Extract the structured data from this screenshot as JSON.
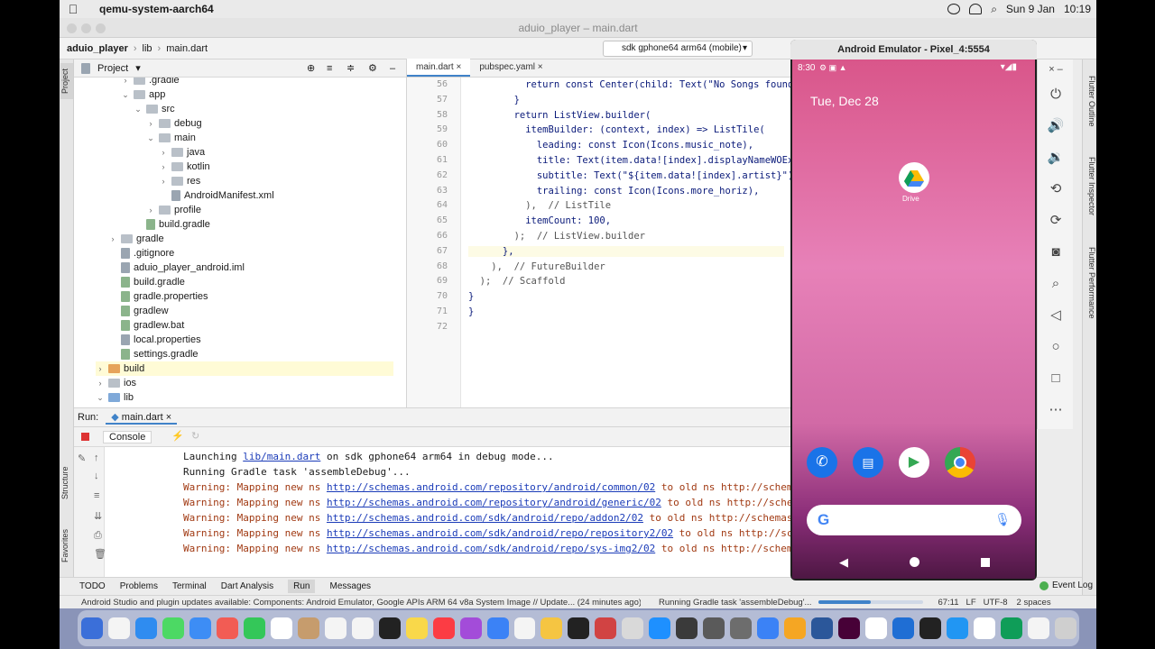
{
  "mac_menubar": {
    "apple": "",
    "app_name": "qemu-system-aarch64",
    "date": "Sun 9 Jan",
    "time": "10:19"
  },
  "window": {
    "title": "aduio_player – main.dart"
  },
  "nav": {
    "project": "aduio_player",
    "dir": "lib",
    "file": "main.dart",
    "device": "sdk gphone64 arm64 (mobile)"
  },
  "left_tool_tabs": [
    "Project",
    "Structure",
    "Favorites"
  ],
  "project_panel": {
    "title": "Project",
    "items": [
      {
        "label": ".gradle",
        "depth": 2,
        "arrow": "›",
        "kind": "folder"
      },
      {
        "label": "app",
        "depth": 2,
        "arrow": "⌄",
        "kind": "folder"
      },
      {
        "label": "src",
        "depth": 3,
        "arrow": "⌄",
        "kind": "folder"
      },
      {
        "label": "debug",
        "depth": 4,
        "arrow": "›",
        "kind": "folder"
      },
      {
        "label": "main",
        "depth": 4,
        "arrow": "⌄",
        "kind": "folder"
      },
      {
        "label": "java",
        "depth": 5,
        "arrow": "›",
        "kind": "folder"
      },
      {
        "label": "kotlin",
        "depth": 5,
        "arrow": "›",
        "kind": "folder"
      },
      {
        "label": "res",
        "depth": 5,
        "arrow": "›",
        "kind": "folder"
      },
      {
        "label": "AndroidManifest.xml",
        "depth": 5,
        "arrow": "",
        "kind": "file"
      },
      {
        "label": "profile",
        "depth": 4,
        "arrow": "›",
        "kind": "folder"
      },
      {
        "label": "build.gradle",
        "depth": 3,
        "arrow": "",
        "kind": "file"
      },
      {
        "label": "gradle",
        "depth": 1,
        "arrow": "›",
        "kind": "folder"
      },
      {
        "label": ".gitignore",
        "depth": 1,
        "arrow": "",
        "kind": "file"
      },
      {
        "label": "aduio_player_android.iml",
        "depth": 1,
        "arrow": "",
        "kind": "file"
      },
      {
        "label": "build.gradle",
        "depth": 1,
        "arrow": "",
        "kind": "file"
      },
      {
        "label": "gradle.properties",
        "depth": 1,
        "arrow": "",
        "kind": "file"
      },
      {
        "label": "gradlew",
        "depth": 1,
        "arrow": "",
        "kind": "file"
      },
      {
        "label": "gradlew.bat",
        "depth": 1,
        "arrow": "",
        "kind": "file"
      },
      {
        "label": "local.properties",
        "depth": 1,
        "arrow": "",
        "kind": "file"
      },
      {
        "label": "settings.gradle",
        "depth": 1,
        "arrow": "",
        "kind": "file"
      },
      {
        "label": "build",
        "depth": 0,
        "arrow": "›",
        "kind": "folder-orange"
      },
      {
        "label": "ios",
        "depth": 0,
        "arrow": "›",
        "kind": "folder"
      },
      {
        "label": "lib",
        "depth": 0,
        "arrow": "⌄",
        "kind": "folder-blue"
      }
    ]
  },
  "editor": {
    "tabs": [
      {
        "label": "main.dart",
        "active": true
      },
      {
        "label": "pubspec.yaml",
        "active": false
      }
    ],
    "lines": [
      {
        "n": "56",
        "code": "          return const Center(child: Text(\"No Songs found"
      },
      {
        "n": "57",
        "code": "        }"
      },
      {
        "n": "58",
        "code": "        return ListView.builder("
      },
      {
        "n": "59",
        "code": "          itemBuilder: (context, index) => ListTile("
      },
      {
        "n": "60",
        "code": "            leading: const Icon(Icons.music_note),"
      },
      {
        "n": "61",
        "code": "            title: Text(item.data![index].displayNameWOEx"
      },
      {
        "n": "62",
        "code": "            subtitle: Text(\"${item.data![index].artist}\")"
      },
      {
        "n": "63",
        "code": "            trailing: const Icon(Icons.more_horiz),"
      },
      {
        "n": "64",
        "code": "          ),  // ListTile"
      },
      {
        "n": "65",
        "code": "          itemCount: 100,"
      },
      {
        "n": "66",
        "code": "        );  // ListView.builder"
      },
      {
        "n": "67",
        "code": "      },"
      },
      {
        "n": "68",
        "code": "    ),  // FutureBuilder"
      },
      {
        "n": "69",
        "code": "  );  // Scaffold"
      },
      {
        "n": "70",
        "code": "}"
      },
      {
        "n": "71",
        "code": "}"
      },
      {
        "n": "72",
        "code": ""
      }
    ]
  },
  "run": {
    "label": "Run:",
    "config": "main.dart",
    "console_tab": "Console"
  },
  "console": [
    {
      "pre": "Launching ",
      "link": "lib/main.dart",
      "post": " on sdk gphone64 arm64 in debug mode...",
      "warn": false
    },
    {
      "pre": "Running Gradle task 'assembleDebug'...",
      "link": "",
      "post": "",
      "warn": false
    },
    {
      "pre": "Warning: Mapping new ns ",
      "link": "http://schemas.android.com/repository/android/common/02",
      "post": " to old ns http://schemas.android.com",
      "warn": true
    },
    {
      "pre": "Warning: Mapping new ns ",
      "link": "http://schemas.android.com/repository/android/generic/02",
      "post": " to old ns http://schemas.android.co",
      "warn": true
    },
    {
      "pre": "Warning: Mapping new ns ",
      "link": "http://schemas.android.com/sdk/android/repo/addon2/02",
      "post": " to old ns http://schemas.android.co",
      "warn": true
    },
    {
      "pre": "Warning: Mapping new ns ",
      "link": "http://schemas.android.com/sdk/android/repo/repository2/02",
      "post": " to old ns http://schemas.android",
      "warn": true
    },
    {
      "pre": "Warning: Mapping new ns ",
      "link": "http://schemas.android.com/sdk/android/repo/sys-img2/02",
      "post": " to old ns http://schemas.android.c",
      "warn": true
    }
  ],
  "bottom_tabs": [
    "TODO",
    "Problems",
    "Terminal",
    "Dart Analysis",
    "Run",
    "Messages"
  ],
  "event_log": "Event Log",
  "status": {
    "message": "Android Studio and plugin updates available: Components: Android Emulator, Google APIs ARM 64 v8a System Image // Update... (24 minutes ago)",
    "task": "Running Gradle task 'assembleDebug'...",
    "position": "67:11",
    "line_sep": "LF",
    "encoding": "UTF-8",
    "indent": "2 spaces"
  },
  "emulator": {
    "title": "Android Emulator - Pixel_4:5554",
    "status_time": "8:30",
    "date": "Tue, Dec 28",
    "drive_label": "Drive"
  },
  "right_tool_tabs": [
    "Flutter Outline",
    "Flutter Inspector",
    "Flutter Performance"
  ],
  "colors": {
    "accent": "#4083c9",
    "warning_text": "#a13a13",
    "link": "#1a3bb8"
  }
}
